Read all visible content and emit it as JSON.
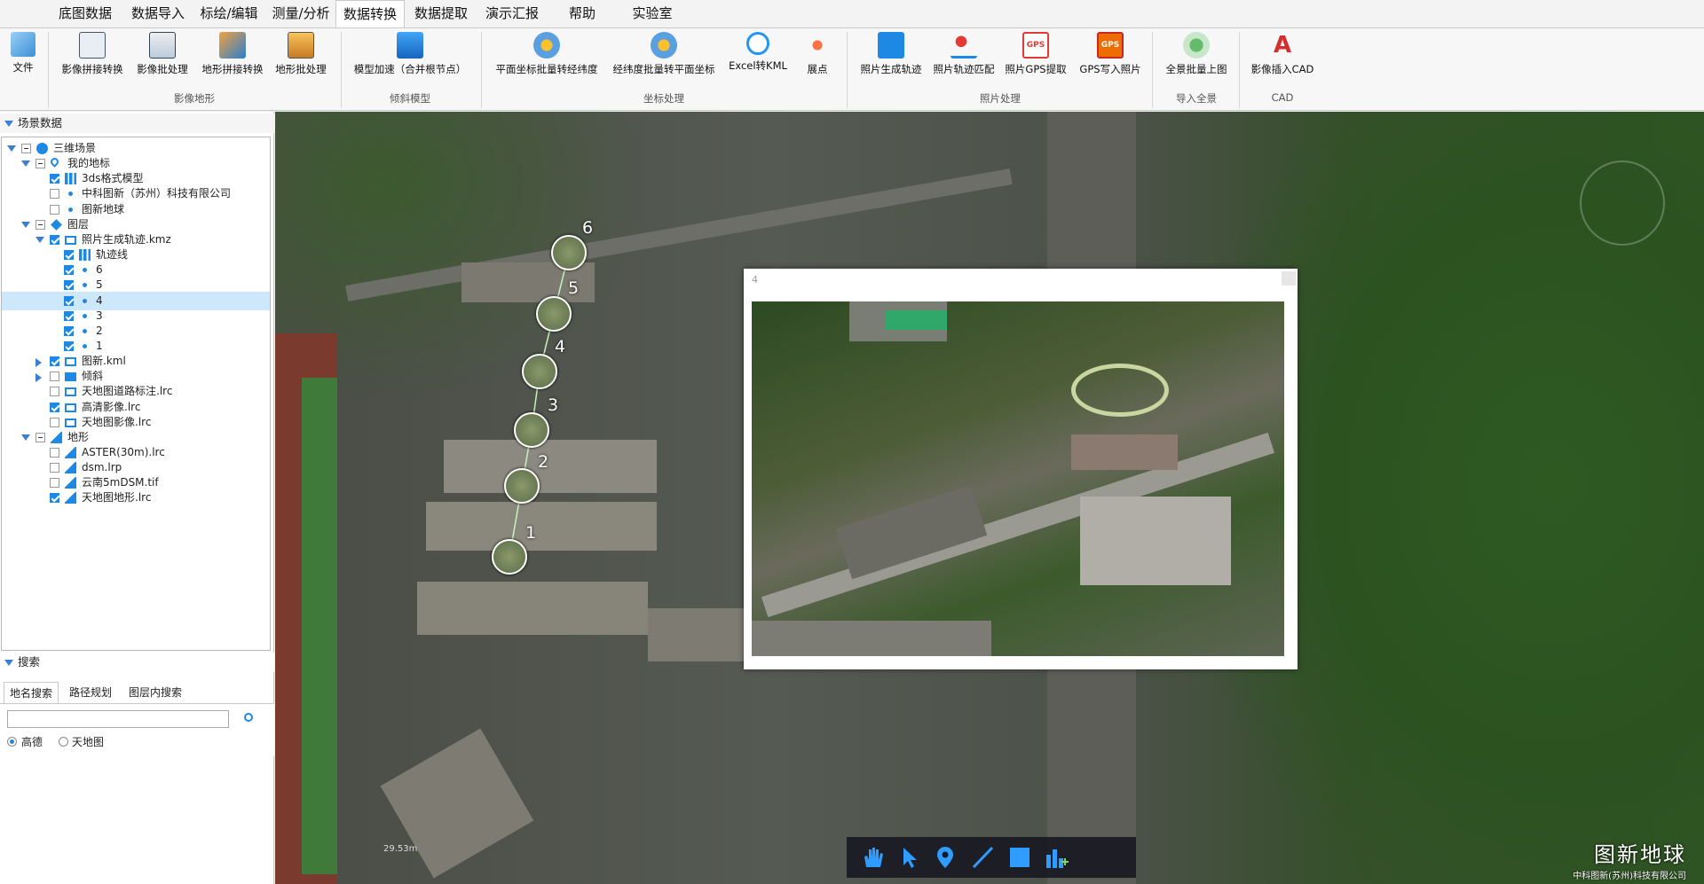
{
  "menu": {
    "tabs": [
      "底图数据",
      "数据导入",
      "标绘/编辑",
      "测量/分析",
      "数据转换",
      "数据提取",
      "演示汇报",
      "帮助",
      "实验室"
    ],
    "active_tab": "数据转换"
  },
  "ribbon": {
    "file_label": "文件",
    "groups": [
      {
        "label": "影像地形",
        "buttons": [
          "影像拼接转换",
          "影像批处理",
          "地形拼接转换",
          "地形批处理"
        ]
      },
      {
        "label": "倾斜模型",
        "buttons": [
          "模型加速（合并根节点）"
        ]
      },
      {
        "label": "坐标处理",
        "buttons": [
          "平面坐标批量转经纬度",
          "经纬度批量转平面坐标",
          "Excel转KML",
          "展点"
        ]
      },
      {
        "label": "照片处理",
        "buttons": [
          "照片生成轨迹",
          "照片轨迹匹配",
          "照片GPS提取",
          "GPS写入照片"
        ]
      },
      {
        "label": "导入全景",
        "buttons": [
          "全景批量上图"
        ]
      },
      {
        "label": "CAD",
        "buttons": [
          "影像插入CAD"
        ]
      }
    ]
  },
  "scene_panel": {
    "title": "场景数据",
    "tree": [
      {
        "label": "三维场景",
        "check": "partial",
        "icon": "globe-icon"
      },
      {
        "label": "我的地标",
        "check": "partial",
        "icon": "pin-icon"
      },
      {
        "label": "3ds格式模型",
        "check": "checked",
        "icon": "model-icon"
      },
      {
        "label": "中科图新（苏州）科技有限公司",
        "check": "none",
        "icon": "point-icon"
      },
      {
        "label": "图新地球",
        "check": "none",
        "icon": "point-icon"
      },
      {
        "label": "图层",
        "check": "partial",
        "icon": "layers-icon"
      },
      {
        "label": "照片生成轨迹.kmz",
        "check": "checked",
        "icon": "monitor-icon"
      },
      {
        "label": "轨迹线",
        "check": "checked",
        "icon": "model-icon"
      },
      {
        "label": "6",
        "check": "checked",
        "icon": "point-icon"
      },
      {
        "label": "5",
        "check": "checked",
        "icon": "point-icon"
      },
      {
        "label": "4",
        "check": "checked",
        "icon": "point-icon"
      },
      {
        "label": "3",
        "check": "checked",
        "icon": "point-icon"
      },
      {
        "label": "2",
        "check": "checked",
        "icon": "point-icon"
      },
      {
        "label": "1",
        "check": "checked",
        "icon": "point-icon"
      },
      {
        "label": "图新.kml",
        "check": "checked",
        "icon": "monitor-icon"
      },
      {
        "label": "倾斜",
        "check": "none",
        "icon": "folder-icon"
      },
      {
        "label": "天地图道路标注.lrc",
        "check": "none",
        "icon": "monitor-icon"
      },
      {
        "label": "高清影像.lrc",
        "check": "checked",
        "icon": "monitor-icon"
      },
      {
        "label": "天地图影像.lrc",
        "check": "none",
        "icon": "monitor-icon"
      },
      {
        "label": "地形",
        "check": "partial",
        "icon": "terrain-icon"
      },
      {
        "label": "ASTER(30m).lrc",
        "check": "none",
        "icon": "terrain-icon"
      },
      {
        "label": "dsm.lrp",
        "check": "none",
        "icon": "terrain-icon"
      },
      {
        "label": "云南5mDSM.tif",
        "check": "none",
        "icon": "terrain-icon"
      },
      {
        "label": "天地图地形.lrc",
        "check": "checked",
        "icon": "terrain-icon"
      }
    ]
  },
  "search_panel": {
    "title": "搜索",
    "tabs": [
      "地名搜索",
      "路径规划",
      "图层内搜索"
    ],
    "input_value": "",
    "sources": [
      "高德",
      "天地图"
    ],
    "selected_source": "高德"
  },
  "map": {
    "markers": [
      "1",
      "2",
      "3",
      "4",
      "5",
      "6"
    ],
    "scale_text": "29.53m",
    "popup": {
      "title": "4"
    },
    "watermark_title": "图新地球",
    "watermark_sub": "中科图新(苏州)科技有限公司"
  },
  "colors": {
    "accent": "#1e88e5",
    "track": "#c8f0c0"
  }
}
